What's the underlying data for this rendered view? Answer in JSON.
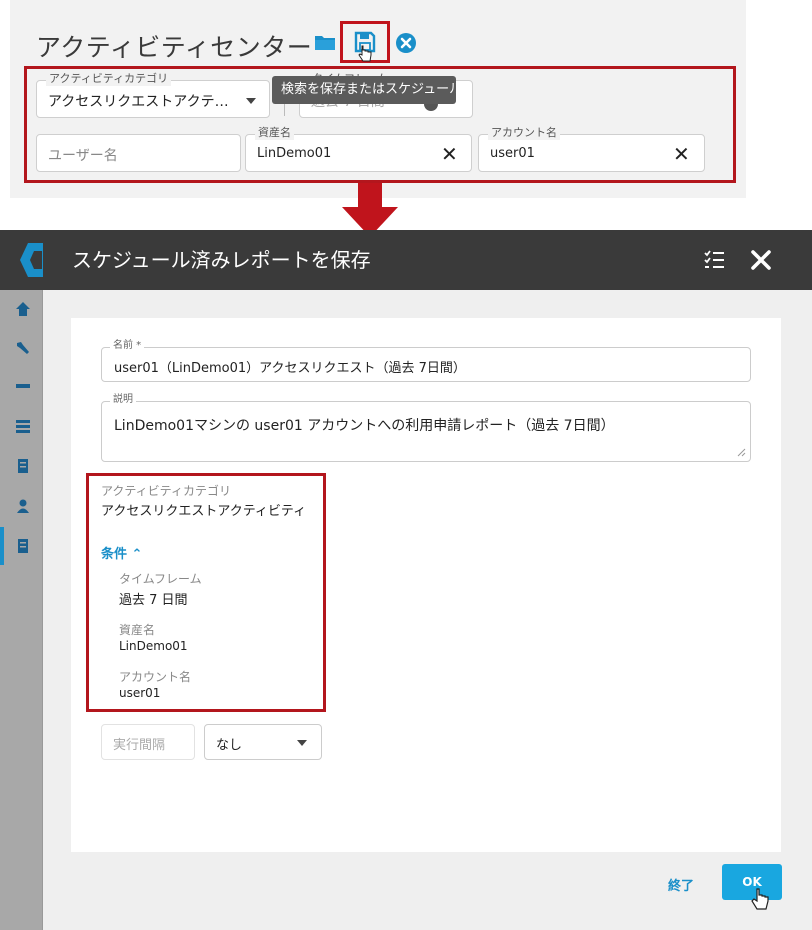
{
  "top": {
    "title": "アクティビティセンター",
    "tooltip": "検索を保存またはスケジュール",
    "filters": {
      "category": {
        "label": "アクティビティカテゴリ",
        "value": "アクセスリクエストアクテ…"
      },
      "timeframe": {
        "label": "タイムフレーム",
        "value": "過去 7 日間"
      },
      "user": {
        "placeholder": "ユーザー名"
      },
      "asset": {
        "label": "資産名",
        "value": "LinDemo01"
      },
      "account": {
        "label": "アカウント名",
        "value": "user01"
      }
    }
  },
  "dialog": {
    "title": "スケジュール済みレポートを保存",
    "name": {
      "label": "名前 *",
      "value": "user01（LinDemo01）アクセスリクエスト（過去 7日間）"
    },
    "description": {
      "label": "説明",
      "value": "LinDemo01マシンの user01 アカウントへの利用申請レポート（過去 7日間）"
    },
    "category": {
      "label": "アクティビティカテゴリ",
      "value": "アクセスリクエストアクティビティ"
    },
    "conditions": {
      "toggle_label": "条件 ⌃",
      "items": [
        {
          "label": "タイムフレーム",
          "value": "過去 7 日間"
        },
        {
          "label": "資産名",
          "value": "LinDemo01"
        },
        {
          "label": "アカウント名",
          "value": "user01"
        }
      ]
    },
    "interval": {
      "label": "実行間隔",
      "value": "なし"
    },
    "buttons": {
      "end": "終了",
      "ok": "OK"
    }
  },
  "colors": {
    "accent": "#1a8fc9",
    "highlight": "#b3161d",
    "header": "#3a3a3a",
    "ok": "#19a7e0"
  },
  "icons": [
    "folder-icon",
    "save-icon",
    "clear-icon",
    "globe-icon",
    "checklist-icon",
    "close-icon",
    "home-icon",
    "tools-icon",
    "asset-icon",
    "list-icon",
    "database-icon",
    "user-icon",
    "report-icon"
  ]
}
